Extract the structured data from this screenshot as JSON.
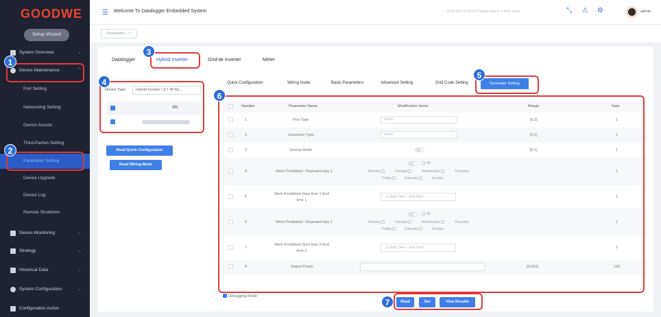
{
  "sidebar": {
    "logo": "GOODWE",
    "setup_wizard": "Setup Wizard",
    "menu": [
      {
        "label": "System Overview",
        "icon": "pie-chart-icon"
      },
      {
        "label": "Device Maintenance",
        "icon": "gear-icon"
      },
      {
        "label": "Device Monitoring",
        "icon": "monitor-icon"
      },
      {
        "label": "Strategy",
        "icon": "strategy-icon"
      },
      {
        "label": "Historical Data",
        "icon": "history-icon"
      },
      {
        "label": "System Configuration",
        "icon": "settings-icon"
      },
      {
        "label": "Configuration Active",
        "icon": "activate-icon"
      }
    ],
    "sub": [
      "Port Setting",
      "Networking Setting",
      "Device Access",
      "Third-Parties Setting",
      "Parameter Setting",
      "Device Upgrade",
      "Device Log",
      "Remote Shutdown"
    ]
  },
  "topbar": {
    "welcome": "Welcome To Datalogger Embedded System",
    "time": "2025-03-14 10:23 Please select a time zone",
    "user": "admin"
  },
  "tag": "Parameter...",
  "tabs": [
    "Datalogger",
    "Hybrid Inverter",
    "Grid-tie Inverter",
    "Meter"
  ],
  "subtabs": [
    "Quick Configuration",
    "Wiring mode",
    "Basic Parameters",
    "Advanced Setting",
    "Grid Code Setting",
    "Generator Setting"
  ],
  "device_type_label": "Device Type",
  "device_type_value": "Hybrid Inverter / ET 40-50...",
  "sn_header": "SN",
  "buttons": {
    "read_quick": "Read Quick Configuration",
    "read_wiring": "Read Wiring Mode",
    "read": "Read",
    "set": "Set",
    "view_results": "View Results"
  },
  "table": {
    "headers": [
      "Number",
      "Parameter Name",
      "Modification Items",
      "Range",
      "Gain"
    ],
    "rows": [
      {
        "num": "1",
        "name": "Port Type",
        "mod": "Select",
        "range": "[0,2]",
        "gain": "1"
      },
      {
        "num": "2",
        "name": "Generator Type",
        "mod": "Select",
        "range": "[0,1]",
        "gain": "1"
      },
      {
        "num": "3",
        "name": "Startup Mode",
        "mod": "",
        "range": "[0,1]",
        "gain": "1"
      },
      {
        "num": "4",
        "name": "Work Prohibited - Repeated day 1",
        "mod": "",
        "range": "",
        "gain": "1"
      },
      {
        "num": "5",
        "name": "Work Prohibited Start time 1-End time 1",
        "mod": "Start Time ~ End Time",
        "range": "",
        "gain": "1"
      },
      {
        "num": "6",
        "name": "Work Prohibited - Repeated day 2",
        "mod": "",
        "range": "",
        "gain": "1"
      },
      {
        "num": "7",
        "name": "Work Prohibited Start time 2-End time 2",
        "mod": "Start Time ~ End Time",
        "range": "",
        "gain": "1"
      },
      {
        "num": "8",
        "name": "Rated Power",
        "mod": "",
        "range": "[0,650]",
        "gain": "100"
      }
    ],
    "all_label": "All",
    "days_line1": [
      "Monday",
      "Tuesday",
      "Wednesday",
      "Thursday"
    ],
    "days_line2": [
      "Friday",
      "Saturday",
      "Sunday"
    ]
  },
  "debug_label": "Debugging Mode",
  "badges": [
    "1",
    "2",
    "3",
    "4",
    "5",
    "6",
    "7"
  ],
  "colors": {
    "accent": "#3f80e8",
    "annotation": "#e03a3a",
    "badge": "#2b6ed8",
    "sidebar": "#1f2230"
  }
}
